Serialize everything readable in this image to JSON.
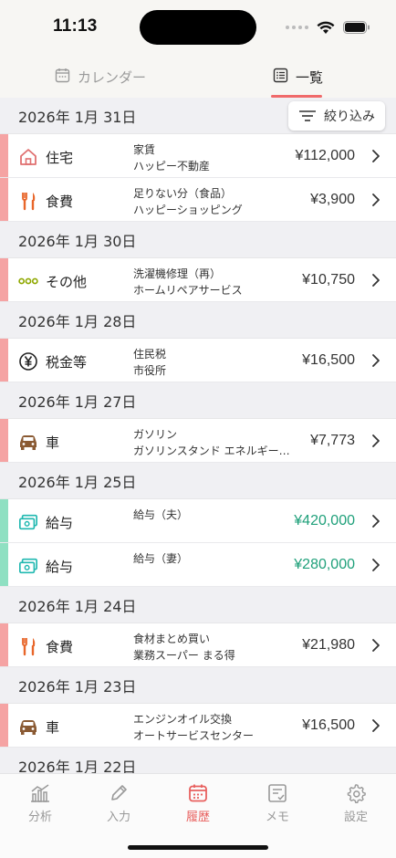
{
  "status": {
    "time": "11:13"
  },
  "top_tabs": [
    {
      "label": "カレンダー",
      "icon": "calendar-icon",
      "active": false
    },
    {
      "label": "一覧",
      "icon": "list-icon",
      "active": true
    }
  ],
  "filter": {
    "label": "絞り込み",
    "icon": "filter-icon"
  },
  "groups": [
    {
      "date": "2026年 1月 31日",
      "items": [
        {
          "category": "住宅",
          "icon": "house-icon",
          "memo1": "家賃",
          "memo2": "ハッピー不動産",
          "amount": "¥112,000",
          "type": "expense"
        },
        {
          "category": "食費",
          "icon": "fork-knife-icon",
          "memo1": "足りない分（食品）",
          "memo2": "ハッピーショッピング",
          "amount": "¥3,900",
          "type": "expense"
        }
      ]
    },
    {
      "date": "2026年 1月 30日",
      "items": [
        {
          "category": "その他",
          "icon": "three-dots-icon",
          "memo1": "洗濯機修理（再）",
          "memo2": "ホームリペアサービス",
          "amount": "¥10,750",
          "type": "expense"
        }
      ]
    },
    {
      "date": "2026年 1月 28日",
      "items": [
        {
          "category": "税金等",
          "icon": "yen-icon",
          "memo1": "住民税",
          "memo2": "市役所",
          "amount": "¥16,500",
          "type": "expense"
        }
      ]
    },
    {
      "date": "2026年 1月 27日",
      "items": [
        {
          "category": "車",
          "icon": "car-icon",
          "memo1": "ガソリン",
          "memo2": "ガソリンスタンド エネルギー…",
          "amount": "¥7,773",
          "type": "expense"
        }
      ]
    },
    {
      "date": "2026年 1月 25日",
      "items": [
        {
          "category": "給与",
          "icon": "money-icon",
          "memo1": "給与（夫）",
          "memo2": "",
          "amount": "¥420,000",
          "type": "income"
        },
        {
          "category": "給与",
          "icon": "money-icon",
          "memo1": "給与（妻）",
          "memo2": "",
          "amount": "¥280,000",
          "type": "income"
        }
      ]
    },
    {
      "date": "2026年 1月 24日",
      "items": [
        {
          "category": "食費",
          "icon": "fork-knife-icon",
          "memo1": "食材まとめ買い",
          "memo2": "業務スーパー まる得",
          "amount": "¥21,980",
          "type": "expense"
        }
      ]
    },
    {
      "date": "2026年 1月 23日",
      "items": [
        {
          "category": "車",
          "icon": "car-icon",
          "memo1": "エンジンオイル交換",
          "memo2": "オートサービスセンター",
          "amount": "¥16,500",
          "type": "expense"
        }
      ]
    },
    {
      "date": "2026年 1月 22日",
      "items": []
    }
  ],
  "bottom_nav": [
    {
      "label": "分析",
      "icon": "chart-icon",
      "active": false
    },
    {
      "label": "入力",
      "icon": "pencil-icon",
      "active": false
    },
    {
      "label": "履歴",
      "icon": "calendar-icon",
      "active": true
    },
    {
      "label": "メモ",
      "icon": "memo-icon",
      "active": false
    },
    {
      "label": "設定",
      "icon": "gear-icon",
      "active": false
    }
  ],
  "colors": {
    "expense_bar": "#f5a3a3",
    "income_bar": "#8fe0c2",
    "income_text": "#1fa07a",
    "accent": "#e8605e"
  }
}
